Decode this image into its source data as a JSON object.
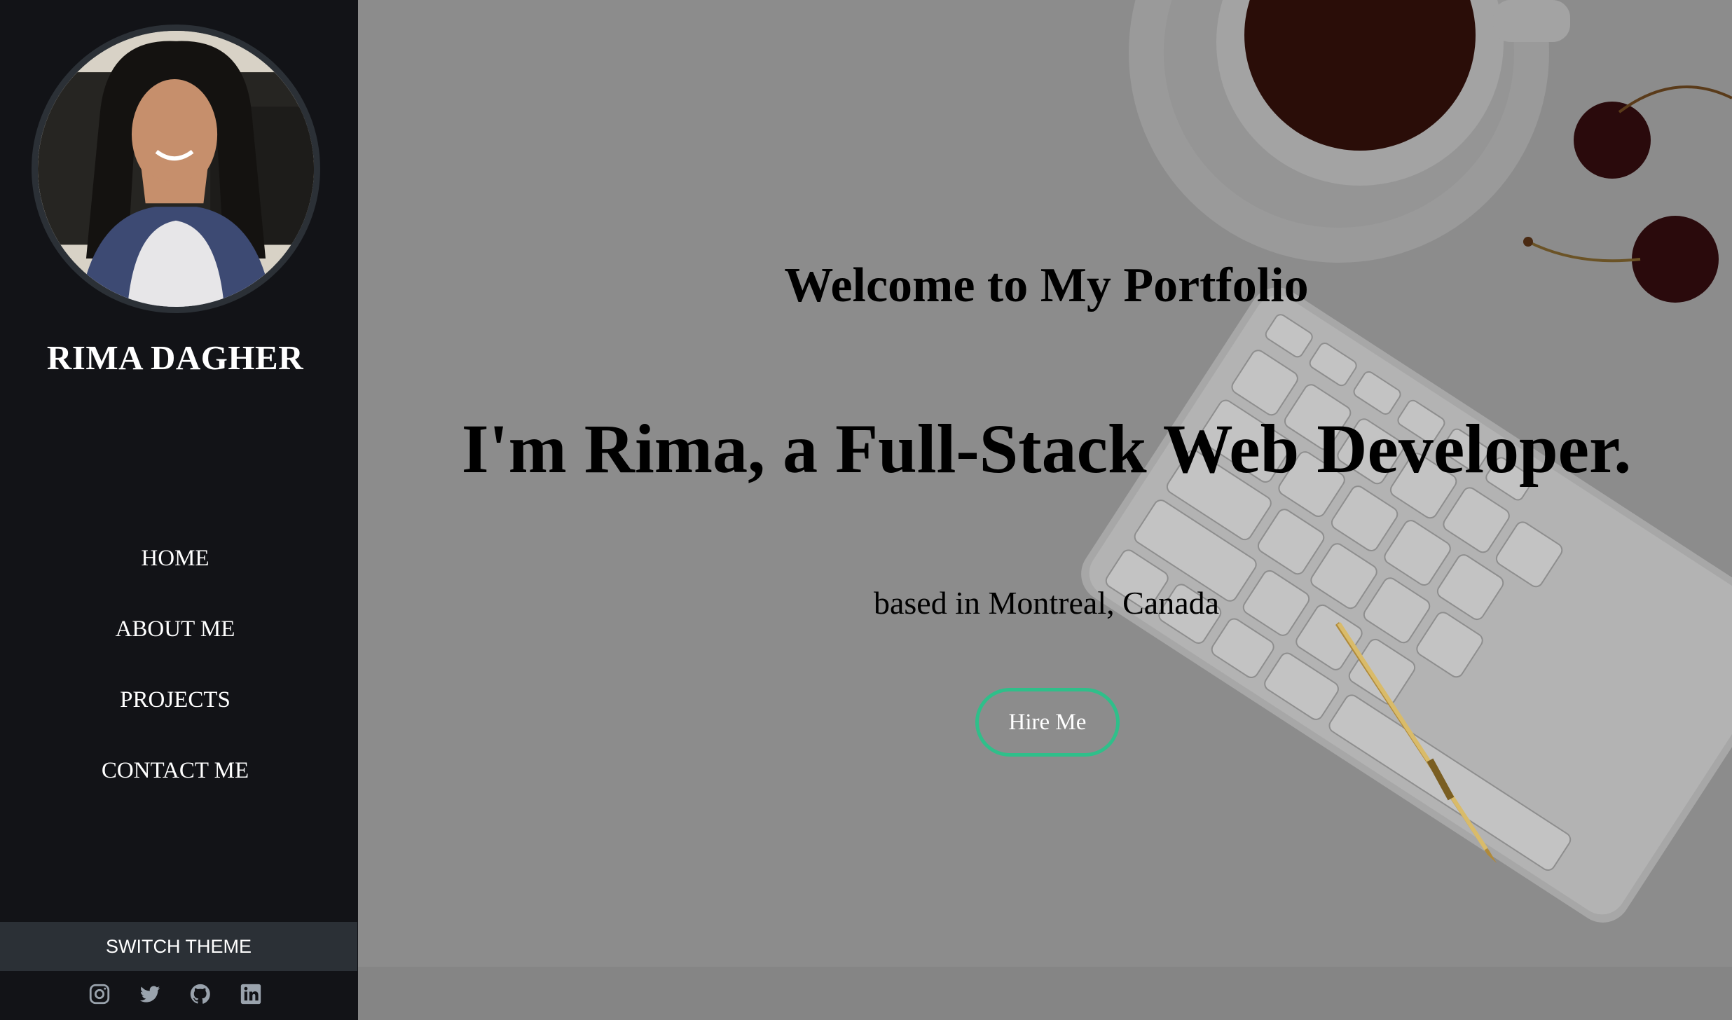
{
  "sidebar": {
    "name": "RIMA DAGHER",
    "nav": [
      {
        "label": "HOME"
      },
      {
        "label": "ABOUT ME"
      },
      {
        "label": "PROJECTS"
      },
      {
        "label": "CONTACT ME"
      }
    ],
    "switch_theme_label": "SWITCH THEME",
    "socials": [
      {
        "icon": "instagram-icon"
      },
      {
        "icon": "twitter-icon"
      },
      {
        "icon": "github-icon"
      },
      {
        "icon": "linkedin-icon"
      }
    ]
  },
  "hero": {
    "welcome": "Welcome to My Portfolio",
    "headline": "I'm Rima, a Full-Stack Web Developer.",
    "location": "based in Montreal, Canada",
    "cta_label": "Hire Me"
  },
  "colors": {
    "sidebar_bg": "#121317",
    "theme_button_bg": "#2b3036",
    "accent": "#2fbf8a"
  }
}
